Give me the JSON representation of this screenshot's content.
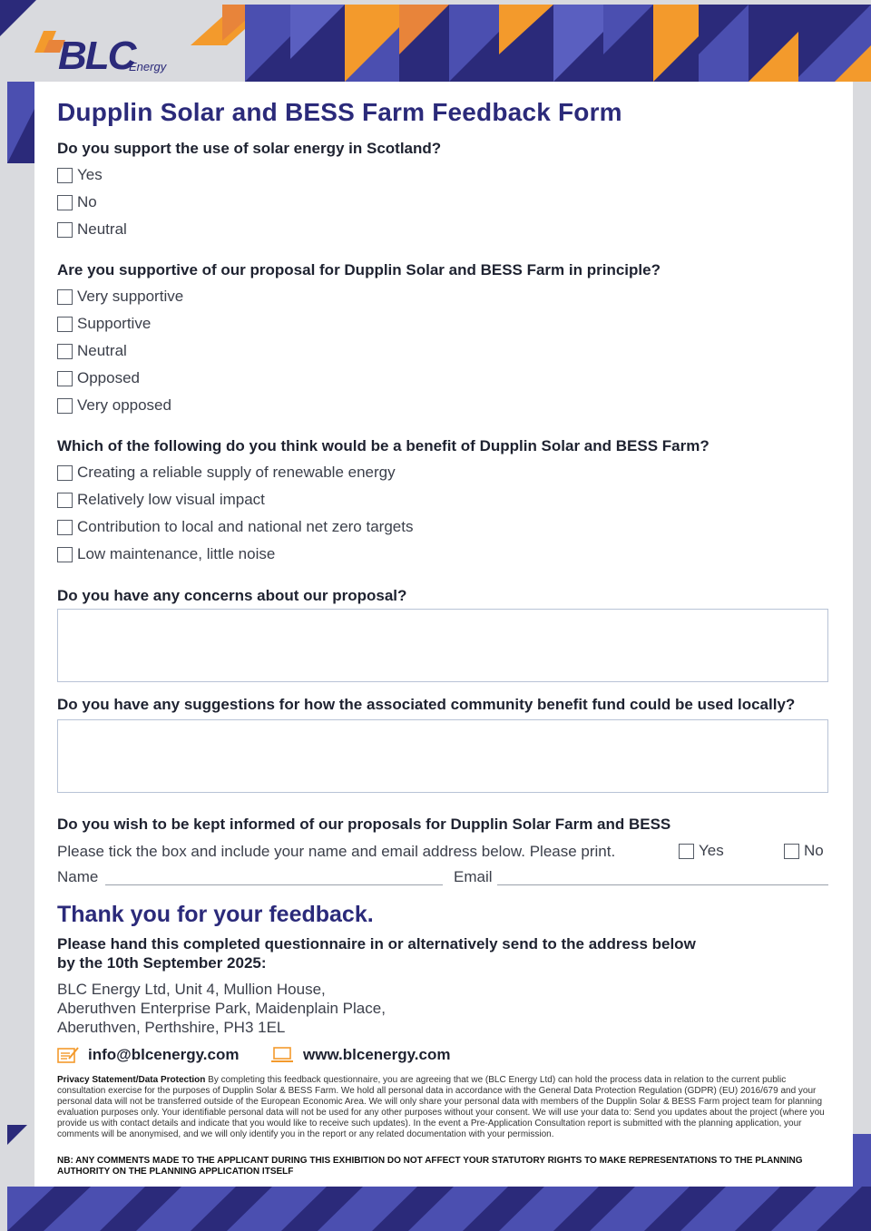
{
  "brand": {
    "logo_text": "BLC",
    "logo_sub": "Energy",
    "colors": {
      "navy": "#2b2a7a",
      "indigo": "#4b4fb0",
      "orange": "#f39a2c",
      "grey": "#d9dade"
    }
  },
  "form": {
    "title": "Dupplin Solar and BESS Farm Feedback Form",
    "q1": {
      "label": "Do you support the use of solar energy in Scotland?",
      "options": [
        "Yes",
        "No",
        "Neutral"
      ]
    },
    "q2": {
      "label": "Are you supportive of our proposal for Dupplin Solar and BESS Farm in principle?",
      "options": [
        "Very supportive",
        "Supportive",
        "Neutral",
        "Opposed",
        "Very opposed"
      ]
    },
    "q3": {
      "label": "Which of the following do you think would be a benefit of Dupplin Solar and BESS Farm?",
      "options": [
        "Creating a reliable supply of renewable energy",
        "Relatively low visual impact",
        "Contribution to local and national net zero targets",
        "Low maintenance, little noise"
      ]
    },
    "q4": {
      "label": "Do you have any concerns about our proposal?"
    },
    "q5": {
      "label": "Do you have any suggestions for how the associated community benefit fund could be used locally?"
    },
    "q6": {
      "label": "Do you wish to be kept informed of our proposals for Dupplin Solar Farm and BESS",
      "instruction": "Please tick the box and include your name and email address below. Please print.",
      "yes": "Yes",
      "no": "No",
      "name_label": "Name",
      "email_label": "Email"
    }
  },
  "closing": {
    "thanks": "Thank you for your feedback.",
    "handin": "Please hand this completed questionnaire in or alternatively send to the address below by the 10th September 2025:",
    "address": [
      "BLC Energy Ltd, Unit 4, Mullion House,",
      "Aberuthven Enterprise Park, Maidenplain Place,",
      "Aberuthven, Perthshire, PH3 1EL"
    ],
    "email": "info@blcenergy.com",
    "website": "www.blcenergy.com"
  },
  "privacy": {
    "heading": "Privacy Statement/Data Protection",
    "body": " By completing this feedback questionnaire, you are agreeing that we (BLC Energy Ltd) can hold the process data in relation to the current public consultation exercise for the purposes of Dupplin Solar & BESS Farm. We hold all personal data in accordance with the General Data Protection Regulation (GDPR) (EU) 2016/679 and your personal data will not be transferred outside of the European Economic Area. We will only share your personal data with members of the Dupplin Solar & BESS Farm project team for planning evaluation purposes only. Your identifiable personal data will not be used for any other purposes without your consent. We will use your data to: Send you updates about the project (where you provide us with contact details and indicate that you would like to receive such updates). In the event a Pre-Application Consultation report is submitted with the planning application, your comments will be anonymised, and we will only identify you in the report or any related documentation with your permission.",
    "nb": "NB: ANY COMMENTS MADE TO THE APPLICANT DURING THIS EXHIBITION DO NOT AFFECT YOUR STATUTORY RIGHTS TO MAKE REPRESENTATIONS TO THE PLANNING AUTHORITY ON THE PLANNING APPLICATION ITSELF"
  }
}
